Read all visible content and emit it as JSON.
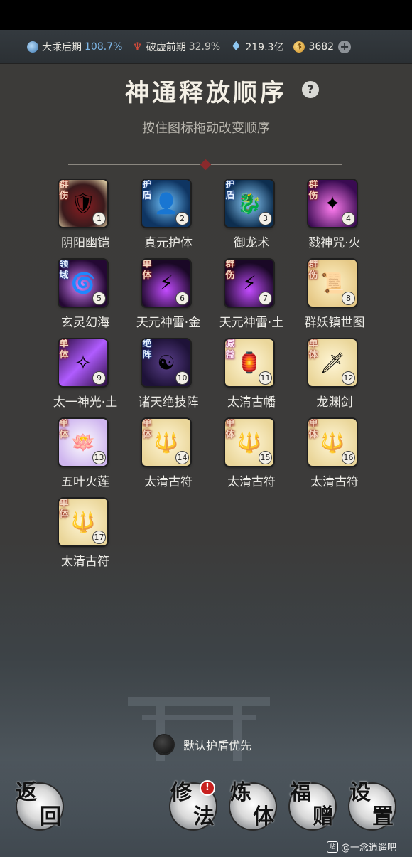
{
  "status": {
    "realm": "大乘后期",
    "realm_pct": "108.7%",
    "break": "破虚前期",
    "break_pct": "32.9%",
    "spirit": "219.3亿",
    "coins": "3682"
  },
  "title": "神通释放顺序",
  "help": "?",
  "subtitle": "按住图标拖动改变顺序",
  "skills": [
    {
      "tag": "群伤",
      "num": "1",
      "name": "阴阳幽铠"
    },
    {
      "tag": "护盾",
      "num": "2",
      "name": "真元护体"
    },
    {
      "tag": "护盾",
      "num": "3",
      "name": "御龙术"
    },
    {
      "tag": "群伤",
      "num": "4",
      "name": "戮神咒·火"
    },
    {
      "tag": "领域",
      "num": "5",
      "name": "玄灵幻海"
    },
    {
      "tag": "单体",
      "num": "6",
      "name": "天元神雷·金"
    },
    {
      "tag": "群伤",
      "num": "7",
      "name": "天元神雷·土"
    },
    {
      "tag": "群伤",
      "num": "8",
      "name": "群妖镇世图"
    },
    {
      "tag": "单体",
      "num": "9",
      "name": "太一神光·土"
    },
    {
      "tag": "绝阵",
      "num": "10",
      "name": "诸天绝技阵"
    },
    {
      "tag": "减益",
      "num": "11",
      "name": "太清古幡"
    },
    {
      "tag": "单体",
      "num": "12",
      "name": "龙渊剑"
    },
    {
      "tag": "单体",
      "num": "13",
      "name": "五叶火莲"
    },
    {
      "tag": "单体",
      "num": "14",
      "name": "太清古符"
    },
    {
      "tag": "单体",
      "num": "15",
      "name": "太清古符"
    },
    {
      "tag": "单体",
      "num": "16",
      "name": "太清古符"
    },
    {
      "tag": "单体",
      "num": "17",
      "name": "太清古符"
    }
  ],
  "toggle_label": "默认护盾优先",
  "nav": {
    "back": "返回",
    "cultivate": "修法",
    "refine": "炼体",
    "gift": "福赠",
    "settings": "设置",
    "badge": "!"
  },
  "watermark": "@一念逍遥吧",
  "colors": {
    "accent_blue": "#7fb8e8",
    "divider_gem": "#8a2a2c",
    "badge_red": "#c8201e"
  }
}
